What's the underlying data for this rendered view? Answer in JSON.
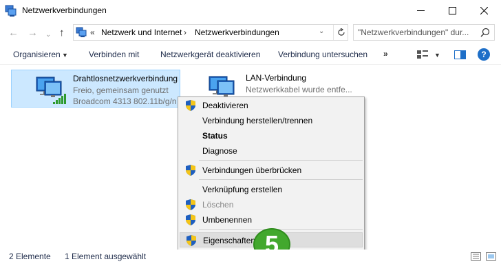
{
  "window": {
    "title": "Netzwerkverbindungen",
    "controls": [
      "minimize-icon",
      "maximize-icon",
      "close-icon"
    ]
  },
  "address": {
    "lead": "«",
    "segments": [
      "Netzwerk und Internet",
      "Netzwerkverbindungen"
    ],
    "separator": "›",
    "search_placeholder": "\"Netzwerkverbindungen\" dur..."
  },
  "toolbar": {
    "organize": "Organisieren",
    "connect": "Verbinden mit",
    "disable": "Netzwerkgerät deaktivieren",
    "diagnose": "Verbindung untersuchen",
    "more": "»"
  },
  "connections": [
    {
      "name": "Drahtlosnetzwerkverbindung",
      "status": "Freio, gemeinsam genutzt",
      "adapter": "Broadcom 4313 802.11b/g/n",
      "selected": true
    },
    {
      "name": "LAN-Verbindung",
      "status": "Netzwerkkabel wurde entfe...",
      "selected": false
    }
  ],
  "context_menu": {
    "items": [
      {
        "label": "Deaktivieren",
        "shield": true,
        "bold": false,
        "disabled": false
      },
      {
        "label": "Verbindung herstellen/trennen",
        "shield": false,
        "bold": false,
        "disabled": false
      },
      {
        "label": "Status",
        "shield": false,
        "bold": true,
        "disabled": false
      },
      {
        "label": "Diagnose",
        "shield": false,
        "bold": false,
        "disabled": false
      },
      {
        "label": "Verbindungen überbrücken",
        "shield": true,
        "bold": false,
        "disabled": false
      },
      {
        "label": "Verknüpfung erstellen",
        "shield": false,
        "bold": false,
        "disabled": false
      },
      {
        "label": "Löschen",
        "shield": true,
        "bold": false,
        "disabled": true
      },
      {
        "label": "Umbenennen",
        "shield": true,
        "bold": false,
        "disabled": false
      },
      {
        "label": "Eigenschaften",
        "shield": true,
        "bold": false,
        "disabled": false,
        "highlighted": true
      }
    ]
  },
  "step_badge": "5",
  "status_bar": {
    "count": "2 Elemente",
    "selection": "1 Element ausgewählt"
  },
  "colors": {
    "selection": "#cce8ff",
    "badge": "#42a82d",
    "help": "#1e6fc8"
  }
}
